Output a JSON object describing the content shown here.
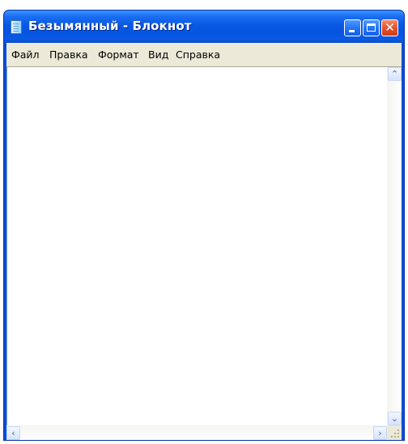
{
  "window": {
    "title": "Безымянный - Блокнот",
    "icon": "notepad-icon",
    "controls": {
      "minimize_icon": "minimize-icon",
      "maximize_icon": "maximize-icon",
      "close_icon": "close-icon",
      "close_glyph": "✕"
    }
  },
  "menu": {
    "items": [
      {
        "label": "Файл"
      },
      {
        "label": "Правка"
      },
      {
        "label": "Формат"
      },
      {
        "label": "Вид"
      },
      {
        "label": "Справка"
      }
    ]
  },
  "editor": {
    "content": ""
  },
  "scrollbars": {
    "up_glyph": "⌃",
    "down_glyph": "⌄",
    "left_glyph": "‹",
    "right_glyph": "›"
  },
  "colors": {
    "titlebar": "#0a58e3",
    "close_button": "#e2502c",
    "menubar": "#ece9d8"
  }
}
